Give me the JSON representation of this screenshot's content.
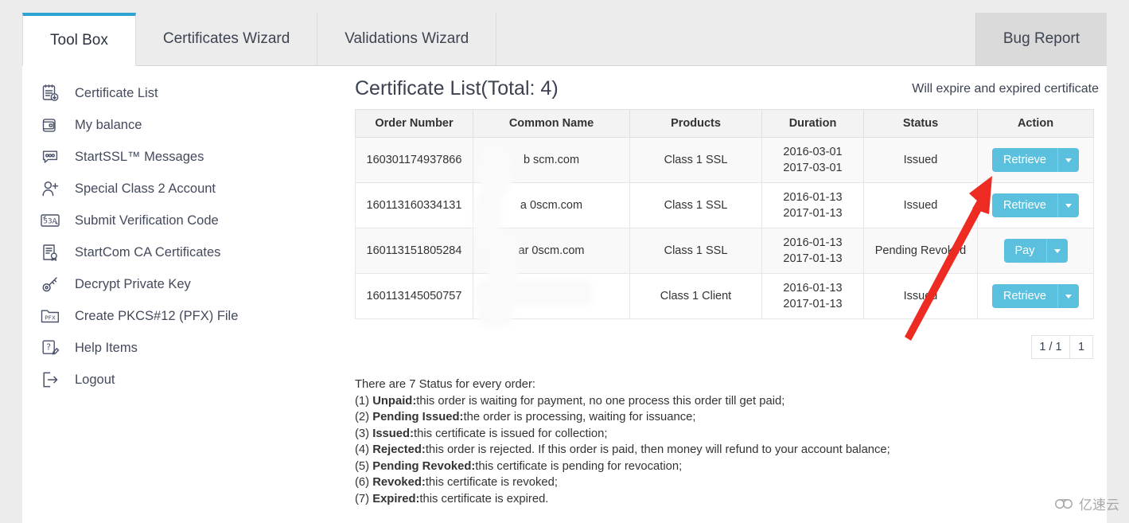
{
  "tabs": [
    {
      "label": "Tool Box",
      "active": true
    },
    {
      "label": "Certificates Wizard",
      "active": false
    },
    {
      "label": "Validations Wizard",
      "active": false
    }
  ],
  "bug_report_tab": "Bug Report",
  "sidebar": {
    "items": [
      {
        "label": "Certificate List",
        "icon": "certificate-list-icon"
      },
      {
        "label": "My balance",
        "icon": "wallet-icon"
      },
      {
        "label": "StartSSL™ Messages",
        "icon": "message-bubble-icon"
      },
      {
        "label": "Special Class 2 Account",
        "icon": "user-add-icon"
      },
      {
        "label": "Submit Verification Code",
        "icon": "captcha-icon"
      },
      {
        "label": "StartCom CA Certificates",
        "icon": "certificate-seal-icon"
      },
      {
        "label": "Decrypt Private Key",
        "icon": "key-icon"
      },
      {
        "label": "Create PKCS#12 (PFX) File",
        "icon": "pfx-folder-icon"
      },
      {
        "label": "Help Items",
        "icon": "help-pencil-icon"
      },
      {
        "label": "Logout",
        "icon": "logout-icon"
      }
    ]
  },
  "main": {
    "title": "Certificate List(Total: 4)",
    "expire_link": "Will expire and expired certificate",
    "table": {
      "columns": [
        "Order Number",
        "Common Name",
        "Products",
        "Duration",
        "Status",
        "Action"
      ],
      "rows": [
        {
          "order_number": "160301174937866",
          "common_name": "b        scm.com",
          "product": "Class 1 SSL",
          "duration_start": "2016-03-01",
          "duration_end": "2017-03-01",
          "status": "Issued",
          "action": "Retrieve"
        },
        {
          "order_number": "160113160334131",
          "common_name": "a      0scm.com",
          "product": "Class 1 SSL",
          "duration_start": "2016-01-13",
          "duration_end": "2017-01-13",
          "status": "Issued",
          "action": "Retrieve"
        },
        {
          "order_number": "160113151805284",
          "common_name": "ar     0scm.com",
          "product": "Class 1 SSL",
          "duration_start": "2016-01-13",
          "duration_end": "2017-01-13",
          "status": "Pending Revoked",
          "action": "Pay"
        },
        {
          "order_number": "160113145050757",
          "common_name": "",
          "product": "Class 1 Client",
          "duration_start": "2016-01-13",
          "duration_end": "2017-01-13",
          "status": "Issued",
          "action": "Retrieve"
        }
      ]
    },
    "pagination": {
      "ratio": "1 / 1",
      "current_page": "1"
    },
    "legend": {
      "intro": "There are 7 Status for every order:",
      "entries": [
        {
          "num": "(1) ",
          "term": "Unpaid:",
          "desc": "this order is waiting for payment, no one process this order till get paid;"
        },
        {
          "num": "(2) ",
          "term": "Pending Issued:",
          "desc": "the order is processing, waiting for issuance;"
        },
        {
          "num": "(3) ",
          "term": "Issued:",
          "desc": "this certificate is issued for collection;"
        },
        {
          "num": "(4) ",
          "term": "Rejected:",
          "desc": "this order is rejected. If this order is paid, then money will refund to your account balance;"
        },
        {
          "num": "(5) ",
          "term": "Pending Revoked:",
          "desc": "this certificate is pending for revocation;"
        },
        {
          "num": "(6) ",
          "term": "Revoked:",
          "desc": "this certificate is revoked;"
        },
        {
          "num": "(7) ",
          "term": "Expired:",
          "desc": "this certificate is expired."
        }
      ]
    }
  },
  "annotation": {
    "type": "red-arrow",
    "color": "#ee2b22"
  },
  "watermark": {
    "text": "亿速云",
    "icon": "cloud-icon"
  },
  "colors": {
    "accent": "#2fa3d3",
    "button": "#5bc0de",
    "text": "#3b4252",
    "arrow": "#ee2b22"
  }
}
